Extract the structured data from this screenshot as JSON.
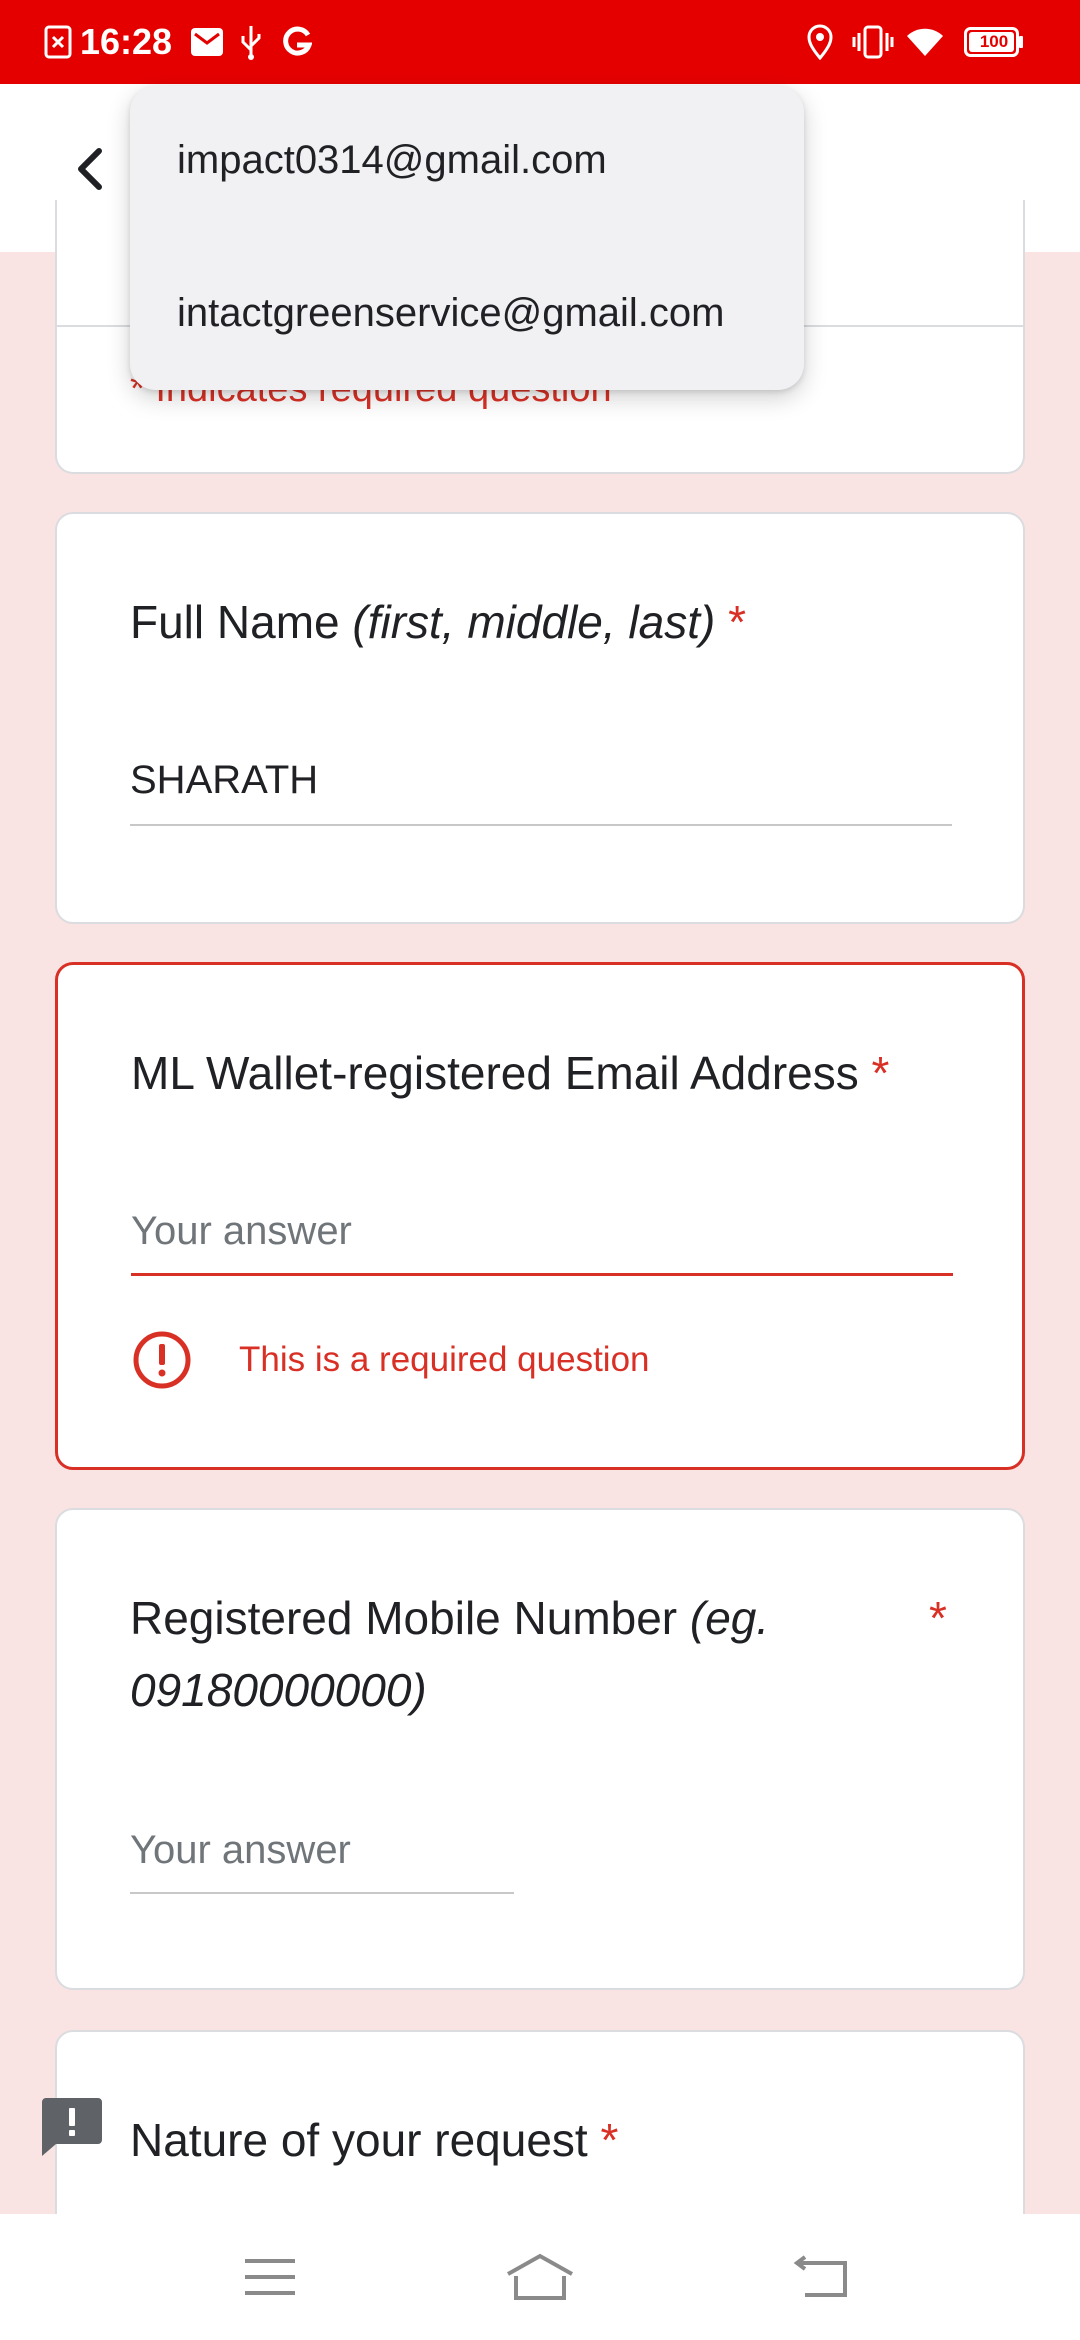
{
  "status_bar": {
    "time": "16:28",
    "battery": "100",
    "left_icons": [
      "screenshot-icon",
      "mail-icon",
      "usb-icon",
      "google-icon"
    ],
    "right_icons": [
      "location-icon",
      "vibrate-icon",
      "wifi-icon",
      "battery-icon"
    ],
    "color": "#e50000"
  },
  "autocomplete": {
    "options": [
      "impact0314@gmail.com",
      "intactgreenservice@gmail.com"
    ]
  },
  "header_card": {
    "required_note": "* Indicates required question"
  },
  "questions": [
    {
      "title": "Full Name ",
      "hint": "(first, middle, last)",
      "required_mark": "*",
      "value": "SHARATH"
    },
    {
      "title": "ML Wallet-registered Email Address ",
      "required_mark": "*",
      "placeholder": "Your answer",
      "error": "This is a required question"
    },
    {
      "title": "Registered Mobile Number ",
      "hint_line1": "(eg.",
      "hint_line2": "09180000000)",
      "required_mark": "*",
      "placeholder": "Your answer"
    },
    {
      "title": "Nature of your request ",
      "required_mark": "*"
    }
  ],
  "colors": {
    "accent": "#d93025",
    "background": "#fae3e3"
  },
  "nav_bar": {
    "icons": [
      "menu-icon",
      "home-icon",
      "back-icon"
    ]
  }
}
